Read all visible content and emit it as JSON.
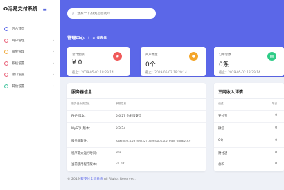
{
  "app": {
    "brand": "O泡易支付系统"
  },
  "search": {
    "placeholder": "搜索一下,找到您想说的"
  },
  "breadcrumb": {
    "title": "管理中心",
    "current": "仪表盘"
  },
  "sidebar": {
    "items": [
      {
        "label": "后台首页",
        "icon": "home-icon",
        "color": "#5b67e8",
        "has_chevron": false
      },
      {
        "label": "商户管理",
        "icon": "user-icon",
        "color": "#e85d75",
        "has_chevron": true
      },
      {
        "label": "资金管理",
        "icon": "wallet-icon",
        "color": "#f0a93b",
        "has_chevron": true
      },
      {
        "label": "系统设置",
        "icon": "settings-icon",
        "color": "#e85d75",
        "has_chevron": true
      },
      {
        "label": "接口设置",
        "icon": "api-icon",
        "color": "#e85d75",
        "has_chevron": true
      },
      {
        "label": "其他设置",
        "icon": "puzzle-icon",
        "color": "#3ac29a",
        "has_chevron": true
      }
    ]
  },
  "stats": [
    {
      "label": "总计金额",
      "value": "¥ 0",
      "time": "截止：2019-05-02 18:29:14",
      "icon": "money-icon",
      "color": "#f05a5a"
    },
    {
      "label": "商户数量",
      "value": "0个",
      "time": "截止：2019-05-02 18:29:14",
      "icon": "users-icon",
      "color": "#f4a62a"
    },
    {
      "label": "订单总数",
      "value": "0条",
      "time": "截止：2019-05-02 18:29:14",
      "icon": "cart-icon",
      "color": "#2ecc87"
    }
  ],
  "server": {
    "title": "服务器信息",
    "head_key": "服务器系统信息",
    "head_value": "系统信息",
    "rows": [
      {
        "key": "PHP 版本：",
        "value": "5.6.27 伪彩版安全"
      },
      {
        "key": "MySQL 版本：",
        "value": "5.5.53"
      },
      {
        "key": "服务器软件：",
        "value": "Apache/2.4.23 (Win32) OpenSSL/1.0.2j mod_fcgid/2.3.9"
      },
      {
        "key": "程序最大运行时间：",
        "value": "30s"
      },
      {
        "key": "当前使用程序版本：",
        "value": "v1.0.0"
      }
    ]
  },
  "income": {
    "title": "三网收入详情",
    "head_key": "通道",
    "head_value": "今日",
    "rows": [
      {
        "key": "支付宝",
        "value": "0"
      },
      {
        "key": "微信",
        "value": "0"
      },
      {
        "key": "QQ",
        "value": "0"
      },
      {
        "key": "财付通",
        "value": "0"
      },
      {
        "key": "总和",
        "value": "0"
      }
    ]
  },
  "footer": {
    "prefix": "© 2019",
    "link": "聚支付全新系统",
    "suffix": "All Rights Reserved."
  }
}
